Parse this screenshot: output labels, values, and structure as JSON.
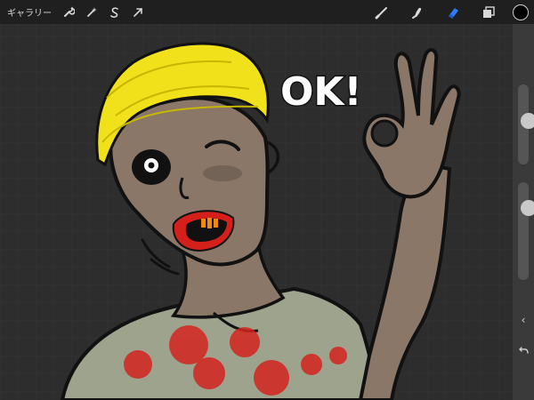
{
  "toolbar": {
    "gallery_label": "ギャラリー",
    "left_icons": [
      "wrench-icon",
      "magic-wand-icon",
      "selection-s-icon",
      "transform-arrow-icon"
    ],
    "right_icons": [
      "brush-icon",
      "smudge-icon",
      "eraser-icon",
      "layers-icon"
    ],
    "active_tool": "eraser-icon",
    "accent_color": "#2f7cf6",
    "current_color": "#000000"
  },
  "artwork": {
    "speech_text": "OK!"
  },
  "sidebar": {
    "brush_size_level": 0.45,
    "opacity_level": 0.7,
    "back_glyph": "‹"
  }
}
